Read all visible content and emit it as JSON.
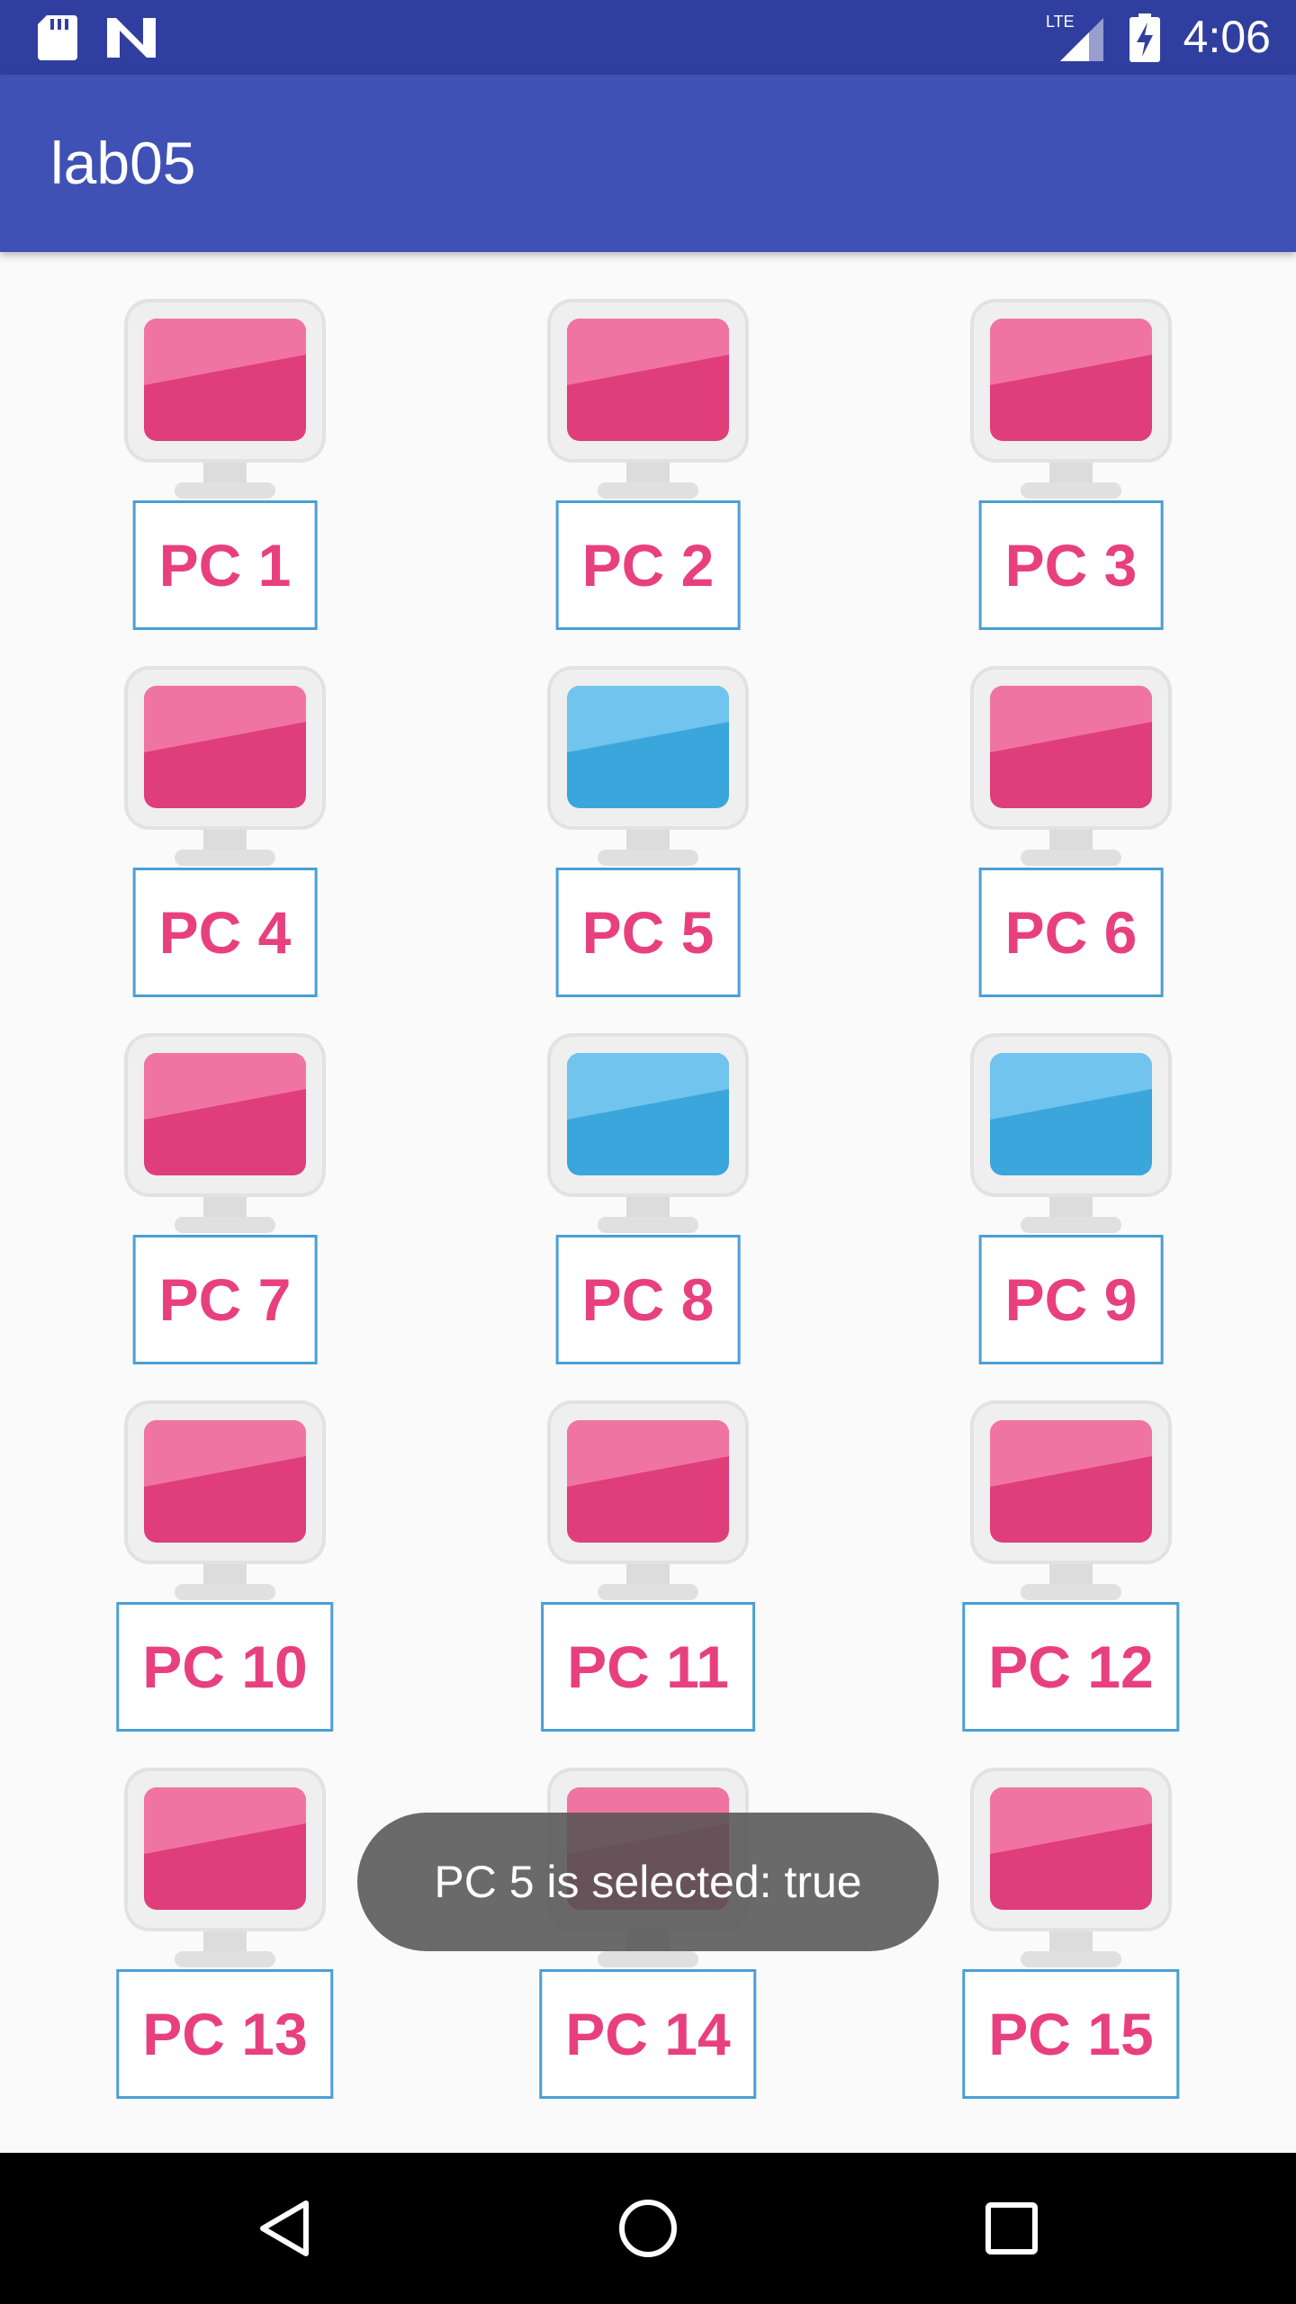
{
  "status_bar": {
    "time": "4:06",
    "network_label": "LTE",
    "icons": [
      "sd-card-icon",
      "n-notification-icon",
      "signal-icon",
      "battery-charging-icon"
    ]
  },
  "app_bar": {
    "title": "lab05"
  },
  "grid": {
    "items": [
      {
        "label": "PC 1",
        "selected": false
      },
      {
        "label": "PC 2",
        "selected": false
      },
      {
        "label": "PC 3",
        "selected": false
      },
      {
        "label": "PC 4",
        "selected": false
      },
      {
        "label": "PC 5",
        "selected": true
      },
      {
        "label": "PC 6",
        "selected": false
      },
      {
        "label": "PC 7",
        "selected": false
      },
      {
        "label": "PC 8",
        "selected": true
      },
      {
        "label": "PC 9",
        "selected": true
      },
      {
        "label": "PC 10",
        "selected": false
      },
      {
        "label": "PC 11",
        "selected": false
      },
      {
        "label": "PC 12",
        "selected": false
      },
      {
        "label": "PC 13",
        "selected": false
      },
      {
        "label": "PC 14",
        "selected": false
      },
      {
        "label": "PC 15",
        "selected": false
      }
    ]
  },
  "toast": {
    "message": "PC 5 is selected: true"
  },
  "colors": {
    "status_bar": "#303f9f",
    "app_bar": "#3f51b5",
    "screen_unselected": "#e03d7b",
    "screen_selected": "#3aa6dc",
    "label_text": "#e8407f",
    "label_border": "#4a9fd5"
  },
  "nav_bar": {
    "buttons": [
      "back-icon",
      "home-icon",
      "recents-icon"
    ]
  }
}
